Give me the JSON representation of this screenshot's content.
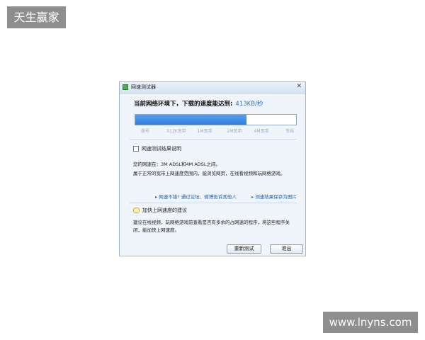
{
  "watermarks": {
    "top_left": "天生赢家",
    "bottom_right": "www.lnyns.com"
  },
  "window": {
    "title": "网速测试器",
    "close_glyph": "✕"
  },
  "speed": {
    "headline": "当前网络环境下，下载的速度能达到:",
    "value": "413KB/秒",
    "progress_fraction": 0.69
  },
  "ticks": [
    "拨号",
    "512K宽带",
    "1M宽带",
    "2M宽带",
    "4M宽带",
    "专线"
  ],
  "result": {
    "section_title": "网速测试结果说明",
    "line1": "您的网速在：3M ADSL和4M ADSL之间。",
    "line2": "属于正常的宽带上网速度范围内，能浏览网页，在线看视频和玩网络游戏。"
  },
  "links": {
    "share": "网速不错? 通过论坛、微博告诉其他人",
    "save": "测速结果保存为图片"
  },
  "tips": {
    "title": "加快上网速度的建议",
    "text": "建议在线视频、玩网络游戏前查看是否有多余的占网速的程序，将这些程序关闭，能加快上网速度。"
  },
  "buttons": {
    "retest": "重新测试",
    "exit": "退出"
  },
  "icons": {
    "app": "network-speed-app-icon",
    "chart": "chart-doc-icon",
    "tip": "lightbulb-icon",
    "link_arrow": "▸"
  }
}
